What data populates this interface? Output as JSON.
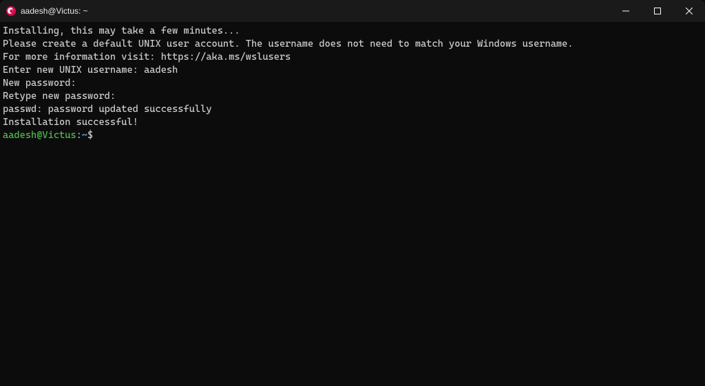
{
  "titlebar": {
    "title": "aadesh@Victus: ~"
  },
  "terminal": {
    "lines": [
      "Installing, this may take a few minutes...",
      "Please create a default UNIX user account. The username does not need to match your Windows username.",
      "For more information visit: https://aka.ms/wslusers",
      "Enter new UNIX username: aadesh",
      "New password:",
      "Retype new password:",
      "passwd: password updated successfully",
      "Installation successful!"
    ],
    "prompt": {
      "user_host": "aadesh@Victus",
      "colon": ":",
      "path": "~",
      "dollar": "$"
    }
  }
}
